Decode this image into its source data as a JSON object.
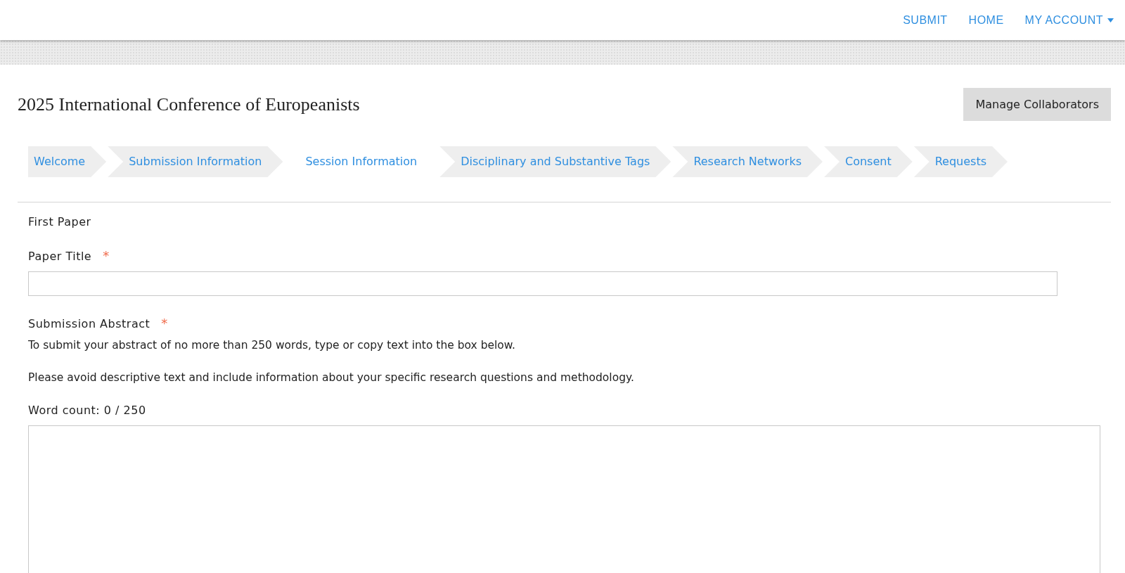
{
  "nav": [
    {
      "label": "SUBMIT",
      "dropdown": false
    },
    {
      "label": "HOME",
      "dropdown": false
    },
    {
      "label": "MY ACCOUNT",
      "dropdown": true
    }
  ],
  "page_title": "2025 International Conference of Europeanists",
  "manage_button": "Manage Collaborators",
  "steps": [
    {
      "label": "Welcome",
      "selected": false
    },
    {
      "label": "Submission Information",
      "selected": false
    },
    {
      "label": "Session Information",
      "selected": true
    },
    {
      "label": "Disciplinary and Substantive Tags",
      "selected": false
    },
    {
      "label": "Research Networks",
      "selected": false
    },
    {
      "label": "Consent",
      "selected": false
    },
    {
      "label": "Requests",
      "selected": false
    }
  ],
  "section_title": "First Paper",
  "fields": [
    {
      "kind": "input",
      "label": "Paper Title",
      "required": true,
      "required_mark": "*"
    },
    {
      "kind": "textarea",
      "label": "Submission Abstract",
      "required": true,
      "required_mark": "*",
      "help": [
        "To submit your abstract of no more than 250 words, type or copy text into the box below.",
        "Please avoid descriptive text and include information about your specific research questions and methodology."
      ],
      "word_count": "Word count: 0 / 250"
    }
  ]
}
